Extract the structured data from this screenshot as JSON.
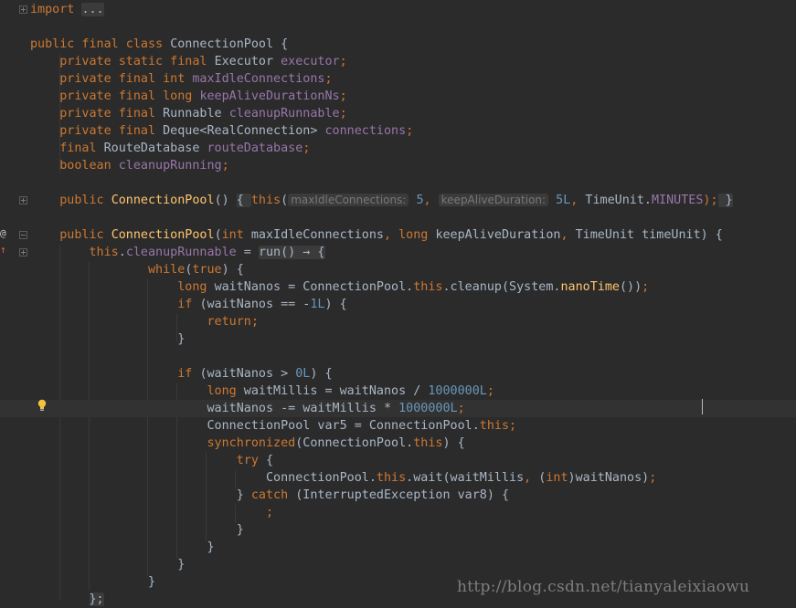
{
  "editor": {
    "lines": [
      [
        {
          "t": "import",
          "c": "kw"
        },
        {
          "t": " "
        },
        {
          "t": "...",
          "c": "fold"
        }
      ],
      [],
      [
        {
          "t": "public final class ",
          "c": "kw"
        },
        {
          "t": "ConnectionPool {"
        }
      ],
      [
        {
          "t": "    "
        },
        {
          "t": "private static final ",
          "c": "kw"
        },
        {
          "t": "Executor "
        },
        {
          "t": "executor",
          "c": "field"
        },
        {
          "t": ";",
          "c": "kw"
        }
      ],
      [
        {
          "t": "    "
        },
        {
          "t": "private final int ",
          "c": "kw"
        },
        {
          "t": "maxIdleConnections",
          "c": "field"
        },
        {
          "t": ";",
          "c": "kw"
        }
      ],
      [
        {
          "t": "    "
        },
        {
          "t": "private final long ",
          "c": "kw"
        },
        {
          "t": "keepAliveDurationNs",
          "c": "field"
        },
        {
          "t": ";",
          "c": "kw"
        }
      ],
      [
        {
          "t": "    "
        },
        {
          "t": "private final ",
          "c": "kw"
        },
        {
          "t": "Runnable "
        },
        {
          "t": "cleanupRunnable",
          "c": "field"
        },
        {
          "t": ";",
          "c": "kw"
        }
      ],
      [
        {
          "t": "    "
        },
        {
          "t": "private final ",
          "c": "kw"
        },
        {
          "t": "Deque<RealConnection> "
        },
        {
          "t": "connections",
          "c": "field"
        },
        {
          "t": ";",
          "c": "kw"
        }
      ],
      [
        {
          "t": "    "
        },
        {
          "t": "final ",
          "c": "kw"
        },
        {
          "t": "RouteDatabase "
        },
        {
          "t": "routeDatabase",
          "c": "field"
        },
        {
          "t": ";",
          "c": "kw"
        }
      ],
      [
        {
          "t": "    "
        },
        {
          "t": "boolean ",
          "c": "kw"
        },
        {
          "t": "cleanupRunning",
          "c": "field"
        },
        {
          "t": ";",
          "c": "kw"
        }
      ],
      [],
      [
        {
          "t": "    "
        },
        {
          "t": "public ",
          "c": "kw"
        },
        {
          "t": "ConnectionPool",
          "c": "method"
        },
        {
          "t": "() "
        },
        {
          "t": "{ ",
          "c": "fold"
        },
        {
          "t": "this",
          "c": "kw"
        },
        {
          "t": "("
        },
        {
          "t": "maxIdleConnections:",
          "c": "hint"
        },
        {
          "t": " "
        },
        {
          "t": "5",
          "c": "num"
        },
        {
          "t": ", ",
          "c": "kw"
        },
        {
          "t": "keepAliveDuration:",
          "c": "hint"
        },
        {
          "t": " "
        },
        {
          "t": "5L",
          "c": "num"
        },
        {
          "t": ", ",
          "c": "kw"
        },
        {
          "t": "TimeUnit."
        },
        {
          "t": "MINUTES",
          "c": "field"
        },
        {
          "t": ");",
          "c": "kw"
        },
        {
          "t": " }",
          "c": "fold"
        }
      ],
      [],
      [
        {
          "t": "    "
        },
        {
          "t": "public ",
          "c": "kw"
        },
        {
          "t": "ConnectionPool",
          "c": "method"
        },
        {
          "t": "("
        },
        {
          "t": "int ",
          "c": "kw"
        },
        {
          "t": "maxIdleConnections"
        },
        {
          "t": ", ",
          "c": "kw"
        },
        {
          "t": "long ",
          "c": "kw"
        },
        {
          "t": "keepAliveDuration"
        },
        {
          "t": ", ",
          "c": "kw"
        },
        {
          "t": "TimeUnit timeUnit) {"
        }
      ],
      [
        {
          "t": "        "
        },
        {
          "t": "this",
          "c": "kw"
        },
        {
          "t": "."
        },
        {
          "t": "cleanupRunnable",
          "c": "field"
        },
        {
          "t": " = "
        },
        {
          "t": "run() → {",
          "c": "fold"
        }
      ],
      [
        {
          "t": "                "
        },
        {
          "t": "while",
          "c": "kw"
        },
        {
          "t": "("
        },
        {
          "t": "true",
          "c": "kw"
        },
        {
          "t": ") {"
        }
      ],
      [
        {
          "t": "                    "
        },
        {
          "t": "long ",
          "c": "kw"
        },
        {
          "t": "waitNanos = ConnectionPool."
        },
        {
          "t": "this",
          "c": "kw"
        },
        {
          "t": ".cleanup(System."
        },
        {
          "t": "nanoTime",
          "c": "method"
        },
        {
          "t": "())"
        },
        {
          "t": ";",
          "c": "kw"
        }
      ],
      [
        {
          "t": "                    "
        },
        {
          "t": "if ",
          "c": "kw"
        },
        {
          "t": "(waitNanos == -"
        },
        {
          "t": "1L",
          "c": "num"
        },
        {
          "t": ") {"
        }
      ],
      [
        {
          "t": "                        "
        },
        {
          "t": "return;",
          "c": "kw"
        }
      ],
      [
        {
          "t": "                    }"
        }
      ],
      [],
      [
        {
          "t": "                    "
        },
        {
          "t": "if ",
          "c": "kw"
        },
        {
          "t": "(waitNanos > "
        },
        {
          "t": "0L",
          "c": "num"
        },
        {
          "t": ") {"
        }
      ],
      [
        {
          "t": "                        "
        },
        {
          "t": "long ",
          "c": "kw"
        },
        {
          "t": "waitMillis = waitNanos / "
        },
        {
          "t": "1000000L",
          "c": "num"
        },
        {
          "t": ";",
          "c": "kw"
        }
      ],
      [
        {
          "t": "                        "
        },
        {
          "t": "waitNanos -= waitMillis * "
        },
        {
          "t": "1000000L",
          "c": "num"
        },
        {
          "t": ";",
          "c": "kw"
        }
      ],
      [
        {
          "t": "                        "
        },
        {
          "t": "ConnectionPool var5 = ConnectionPool."
        },
        {
          "t": "this",
          "c": "kw"
        },
        {
          "t": ";",
          "c": "kw"
        }
      ],
      [
        {
          "t": "                        "
        },
        {
          "t": "synchronized",
          "c": "kw"
        },
        {
          "t": "(ConnectionPool."
        },
        {
          "t": "this",
          "c": "kw"
        },
        {
          "t": ") {"
        }
      ],
      [
        {
          "t": "                            "
        },
        {
          "t": "try ",
          "c": "kw"
        },
        {
          "t": "{"
        }
      ],
      [
        {
          "t": "                                "
        },
        {
          "t": "ConnectionPool."
        },
        {
          "t": "this",
          "c": "kw"
        },
        {
          "t": ".wait(waitMillis"
        },
        {
          "t": ", ",
          "c": "kw"
        },
        {
          "t": "("
        },
        {
          "t": "int",
          "c": "kw"
        },
        {
          "t": ")waitNanos)"
        },
        {
          "t": ";",
          "c": "kw"
        }
      ],
      [
        {
          "t": "                            } "
        },
        {
          "t": "catch ",
          "c": "kw"
        },
        {
          "t": "(InterruptedException var8) {"
        }
      ],
      [
        {
          "t": "                                "
        },
        {
          "t": ";",
          "c": "kw"
        }
      ],
      [
        {
          "t": "                            }"
        }
      ],
      [
        {
          "t": "                        }"
        }
      ],
      [
        {
          "t": "                    }"
        }
      ],
      [
        {
          "t": "                }"
        }
      ],
      [
        {
          "t": "        "
        },
        {
          "t": "};",
          "c": "fold"
        }
      ]
    ],
    "current_line": 23,
    "fold_markers": [
      {
        "line": 0,
        "kind": "plus"
      },
      {
        "line": 11,
        "kind": "plus"
      },
      {
        "line": 13,
        "kind": "minus"
      },
      {
        "line": 14,
        "kind": "plus"
      }
    ],
    "gutter_icons": {
      "override": "@",
      "implements": "↑"
    }
  },
  "watermark": "http://blog.csdn.net/tianyaleixiaowu",
  "colors": {
    "background": "#2b2b2b",
    "keyword": "#cc7832",
    "plain": "#a9b7c6",
    "number": "#6897bb",
    "field": "#9876aa",
    "method": "#ffc66d",
    "hint": "#787878"
  }
}
